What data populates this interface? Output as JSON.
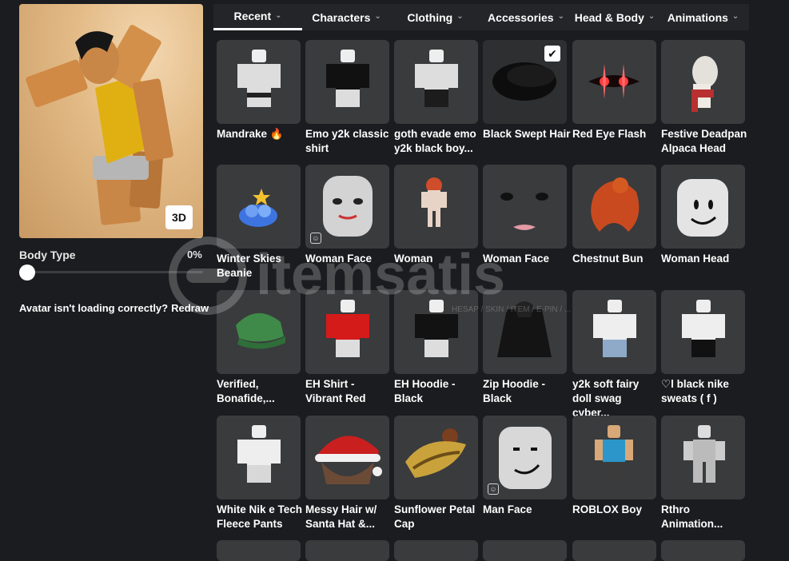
{
  "avatar": {
    "button_3d": "3D"
  },
  "body_type": {
    "label": "Body Type",
    "value": "0%"
  },
  "redraw": {
    "message": "Avatar isn't loading correctly?",
    "link": "Redraw"
  },
  "tabs": [
    {
      "label": "Recent",
      "active": true
    },
    {
      "label": "Characters"
    },
    {
      "label": "Clothing"
    },
    {
      "label": "Accessories"
    },
    {
      "label": "Head & Body"
    },
    {
      "label": "Animations"
    }
  ],
  "items": [
    {
      "line1": "Mandrake 🔥",
      "line2": ""
    },
    {
      "line1": "Emo y2k classic",
      "line2": "shirt"
    },
    {
      "line1": "goth evade emo",
      "line2": "y2k black boy..."
    },
    {
      "line1": "Black Swept Hair",
      "line2": ""
    },
    {
      "line1": "Red Eye Flash",
      "line2": ""
    },
    {
      "line1": "Festive Deadpan",
      "line2": "Alpaca Head"
    },
    {
      "line1": "Winter Skies",
      "line2": "Beanie"
    },
    {
      "line1": "Woman Face",
      "line2": ""
    },
    {
      "line1": "Woman",
      "line2": ""
    },
    {
      "line1": "Woman Face",
      "line2": ""
    },
    {
      "line1": "Chestnut Bun",
      "line2": ""
    },
    {
      "line1": "Woman Head",
      "line2": ""
    },
    {
      "line1": "Verified,",
      "line2": "Bonafide,..."
    },
    {
      "line1": "EH Shirt -",
      "line2": "Vibrant Red"
    },
    {
      "line1": "EH Hoodie -",
      "line2": "Black"
    },
    {
      "line1": "Zip Hoodie -",
      "line2": "Black"
    },
    {
      "line1": "y2k soft fairy",
      "line2": "doll swag cyber..."
    },
    {
      "line1": "♡l black nike",
      "line2": "sweats ( f )"
    },
    {
      "line1": "White Nik e Tech",
      "line2": "Fleece Pants"
    },
    {
      "line1": "Messy Hair w/",
      "line2": "Santa Hat &..."
    },
    {
      "line1": "Sunflower Petal",
      "line2": "Cap"
    },
    {
      "line1": "Man Face",
      "line2": ""
    },
    {
      "line1": "ROBLOX Boy",
      "line2": ""
    },
    {
      "line1": "Rthro",
      "line2": "Animation..."
    }
  ],
  "watermark": {
    "brand": "itemsatis",
    "tagline": "HESAP / SKIN / ITEM / E-PIN / ..."
  },
  "icons": {
    "check": "check-icon",
    "face_badge": "face-icon",
    "chevron": "chevron-down-icon"
  }
}
